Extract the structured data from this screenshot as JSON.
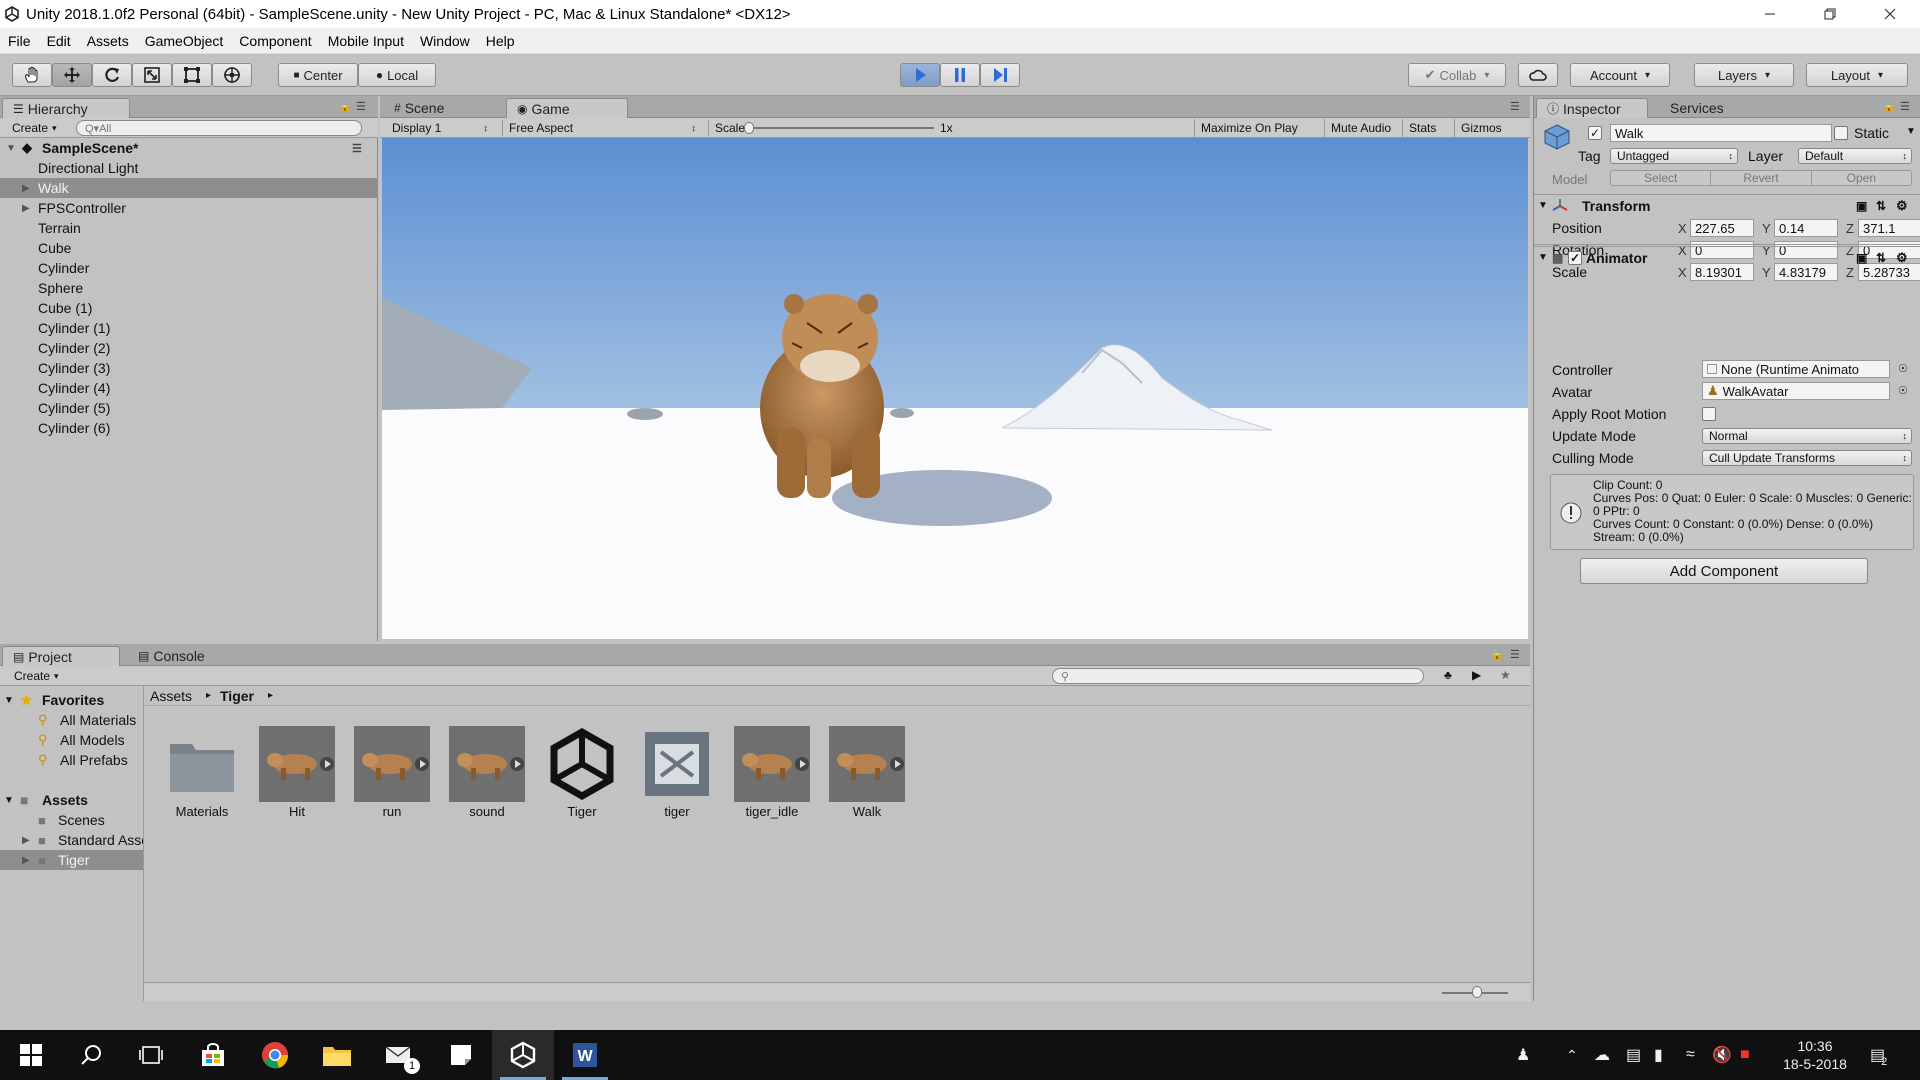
{
  "window": {
    "title": "Unity 2018.1.0f2 Personal (64bit) - SampleScene.unity - New Unity Project - PC, Mac & Linux Standalone* <DX12>"
  },
  "menu": [
    "File",
    "Edit",
    "Assets",
    "GameObject",
    "Component",
    "Mobile Input",
    "Window",
    "Help"
  ],
  "toolbar": {
    "pivot_center": "Center",
    "pivot_local": "Local",
    "collab": "Collab",
    "account": "Account",
    "layers": "Layers",
    "layout": "Layout"
  },
  "hierarchy": {
    "tab": "Hierarchy",
    "create": "Create",
    "search_placeholder": "Q▾All",
    "scene": "SampleScene*",
    "items": [
      {
        "label": "Directional Light",
        "expandable": false,
        "selected": false
      },
      {
        "label": "Walk",
        "expandable": true,
        "selected": true
      },
      {
        "label": "FPSController",
        "expandable": true,
        "selected": false
      },
      {
        "label": "Terrain",
        "expandable": false,
        "selected": false
      },
      {
        "label": "Cube",
        "expandable": false,
        "selected": false
      },
      {
        "label": "Cylinder",
        "expandable": false,
        "selected": false
      },
      {
        "label": "Sphere",
        "expandable": false,
        "selected": false
      },
      {
        "label": "Cube (1)",
        "expandable": false,
        "selected": false
      },
      {
        "label": "Cylinder (1)",
        "expandable": false,
        "selected": false
      },
      {
        "label": "Cylinder (2)",
        "expandable": false,
        "selected": false
      },
      {
        "label": "Cylinder (3)",
        "expandable": false,
        "selected": false
      },
      {
        "label": "Cylinder (4)",
        "expandable": false,
        "selected": false
      },
      {
        "label": "Cylinder (5)",
        "expandable": false,
        "selected": false
      },
      {
        "label": "Cylinder (6)",
        "expandable": false,
        "selected": false
      }
    ]
  },
  "game": {
    "tab_scene": "Scene",
    "tab_game": "Game",
    "display": "Display 1",
    "aspect": "Free Aspect",
    "scale_label": "Scale",
    "scale_value": "1x",
    "maximize": "Maximize On Play",
    "mute": "Mute Audio",
    "stats": "Stats",
    "gizmos": "Gizmos"
  },
  "inspector": {
    "tab": "Inspector",
    "tab_services": "Services",
    "object_name": "Walk",
    "static_label": "Static",
    "tag_label": "Tag",
    "tag_value": "Untagged",
    "layer_label": "Layer",
    "layer_value": "Default",
    "model_label": "Model",
    "select": "Select",
    "revert": "Revert",
    "open": "Open",
    "transform": {
      "title": "Transform",
      "position_label": "Position",
      "rotation_label": "Rotation",
      "scale_label": "Scale",
      "position": {
        "x": "227.65",
        "y": "0.14",
        "z": "371.1"
      },
      "rotation": {
        "x": "0",
        "y": "0",
        "z": "0"
      },
      "scale": {
        "x": "8.19301",
        "y": "4.83179",
        "z": "5.28733"
      }
    },
    "animator": {
      "title": "Animator",
      "controller_label": "Controller",
      "controller_value": "None (Runtime Animato",
      "avatar_label": "Avatar",
      "avatar_value": "WalkAvatar",
      "root_motion_label": "Apply Root Motion",
      "update_mode_label": "Update Mode",
      "update_mode_value": "Normal",
      "culling_label": "Culling Mode",
      "culling_value": "Cull Update Transforms",
      "info": "Clip Count: 0\nCurves Pos: 0 Quat: 0 Euler: 0 Scale: 0 Muscles: 0 Generic: 0 PPtr: 0\nCurves Count: 0 Constant: 0 (0.0%) Dense: 0 (0.0%) Stream: 0 (0.0%)"
    },
    "add_component": "Add Component"
  },
  "project": {
    "tab_project": "Project",
    "tab_console": "Console",
    "create": "Create",
    "breadcrumb": [
      "Assets",
      "Tiger"
    ],
    "favorites_label": "Favorites",
    "favorites": [
      "All Materials",
      "All Models",
      "All Prefabs"
    ],
    "assets_label": "Assets",
    "folders": [
      {
        "label": "Scenes",
        "expandable": false,
        "selected": false
      },
      {
        "label": "Standard Assets",
        "expandable": true,
        "selected": false
      },
      {
        "label": "Tiger",
        "expandable": true,
        "selected": true
      }
    ],
    "assets": [
      {
        "label": "Materials",
        "kind": "folder"
      },
      {
        "label": "Hit",
        "kind": "anim"
      },
      {
        "label": "run",
        "kind": "anim"
      },
      {
        "label": "sound",
        "kind": "anim"
      },
      {
        "label": "Tiger",
        "kind": "unity"
      },
      {
        "label": "tiger",
        "kind": "controller"
      },
      {
        "label": "tiger_idle",
        "kind": "anim"
      },
      {
        "label": "Walk",
        "kind": "anim"
      }
    ]
  },
  "taskbar": {
    "time": "10:36",
    "date": "18-5-2018",
    "notif_count": "2",
    "mail_badge": "1"
  },
  "colors": {
    "editor_bg": "#c2c2c2",
    "selection": "#8e8e8e",
    "play_blue": "#2f6bd6",
    "taskbar": "#101010"
  }
}
